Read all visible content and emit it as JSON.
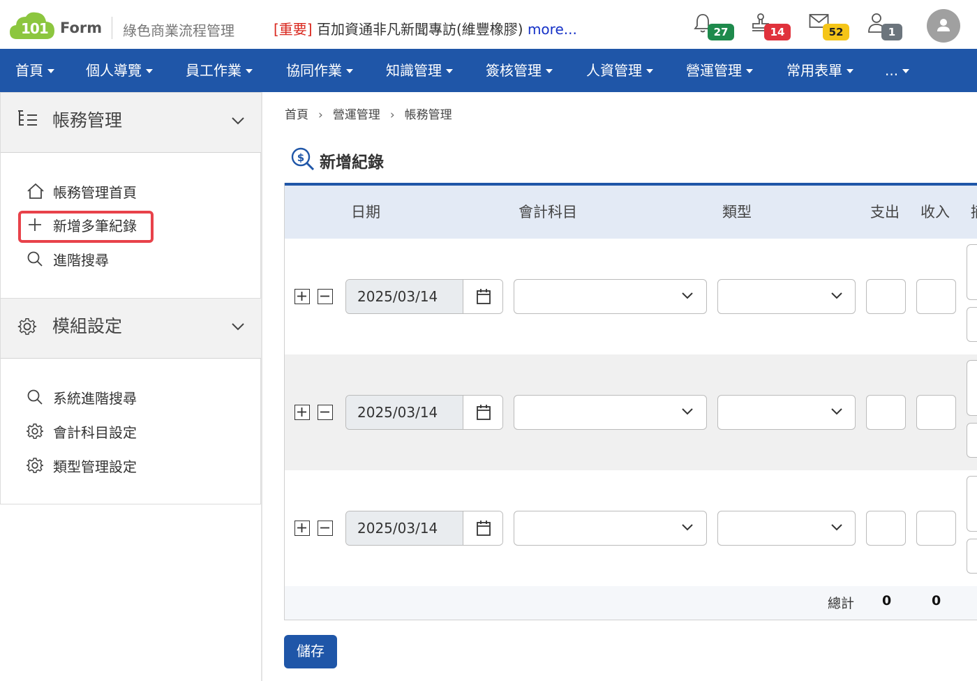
{
  "header": {
    "logo_number": "101",
    "logo_word": "Form",
    "app_subtitle": "綠色商業流程管理",
    "news_tag": "[重要]",
    "news_text": " 百加資通非凡新聞專訪(維豐橡膠) ",
    "news_more": "more...",
    "notifications": [
      {
        "icon": "bell-icon",
        "count": "27",
        "color": "#1e8a4c"
      },
      {
        "icon": "stamp-icon",
        "count": "14",
        "color": "#e0323c"
      },
      {
        "icon": "mail-icon",
        "count": "52",
        "color": "#f5c518"
      },
      {
        "icon": "user-icon",
        "count": "1",
        "color": "#6c757d"
      }
    ]
  },
  "nav": {
    "items": [
      "首頁",
      "個人導覽",
      "員工作業",
      "協同作業",
      "知識管理",
      "簽核管理",
      "人資管理",
      "營運管理",
      "常用表單",
      "..."
    ]
  },
  "sidebar": {
    "sections": [
      {
        "title": "帳務管理",
        "links": [
          "帳務管理首頁",
          "新增多筆紀錄",
          "進階搜尋"
        ]
      },
      {
        "title": "模組設定",
        "links": [
          "系統進階搜尋",
          "會計科目設定",
          "類型管理設定"
        ]
      }
    ]
  },
  "breadcrumb": [
    "首頁",
    "營運管理",
    "帳務管理"
  ],
  "page_title": "新增紀錄",
  "table": {
    "headers": {
      "date": "日期",
      "account": "會計科目",
      "type": "類型",
      "expense": "支出",
      "income": "收入",
      "extra": "摘"
    },
    "rows": [
      {
        "date": "2025/03/14"
      },
      {
        "date": "2025/03/14"
      },
      {
        "date": "2025/03/14"
      }
    ],
    "total_label": "總計",
    "total_expense": "0",
    "total_income": "0"
  },
  "save_label": "儲存",
  "colors": {
    "primary": "#1f56a8",
    "highlight": "#e8424a",
    "header_bg": "#e3eaf5"
  }
}
